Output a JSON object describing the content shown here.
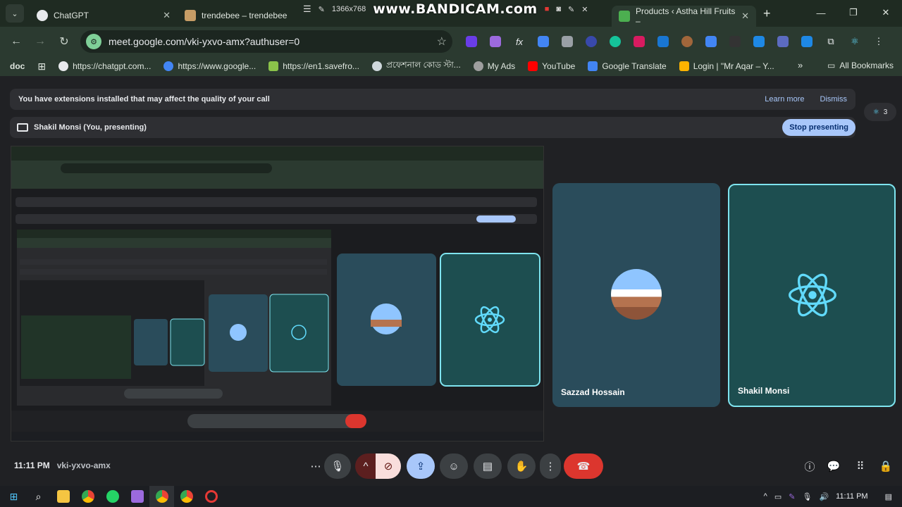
{
  "browser": {
    "tabs": [
      {
        "title": "ChatGPT",
        "color": "#e8eaed"
      },
      {
        "title": "trendebee – trendebee",
        "color": "#c79d66"
      },
      {
        "title": "Products ‹ Astha Hill Fruits –",
        "color": "#4caf50"
      }
    ],
    "recorder": {
      "resolution": "1366x768",
      "watermark": "www.BANDICAM.com"
    },
    "address": "meet.google.com/vki-yxvo-amx?authuser=0",
    "bookmarks": [
      {
        "label": "doc",
        "color": "#e8eaed"
      },
      {
        "label": "https://chatgpt.com...",
        "color": "#e8eaed"
      },
      {
        "label": "https://www.google...",
        "color": "#4285f4"
      },
      {
        "label": "https://en1.savefro...",
        "color": "#8bc34a"
      },
      {
        "label": "প্রফেশনাল কোড স্টা...",
        "color": "#cfd8dc"
      },
      {
        "label": "My Ads",
        "color": "#9e9e9e"
      },
      {
        "label": "YouTube",
        "color": "#ff0000"
      },
      {
        "label": "Google Translate",
        "color": "#4285f4"
      },
      {
        "label": "Login | \"Mr Aqar – Y...",
        "color": "#ffb300"
      }
    ],
    "all_bookmarks": "All Bookmarks"
  },
  "meet": {
    "notice": "You have extensions installed that may affect the quality of your call",
    "learn_more": "Learn more",
    "dismiss": "Dismiss",
    "people_count": "3",
    "presenting": "Shakil Monsi (You, presenting)",
    "stop_presenting": "Stop presenting",
    "participants": [
      {
        "name": "Sazzad Hossain"
      },
      {
        "name": "Shakil Monsi"
      }
    ],
    "time": "11:11 PM",
    "meeting_code": "vki-yxvo-amx",
    "accent": "#7fe4ef",
    "end_call_color": "#dc362e"
  },
  "taskbar": {
    "time": "11:11 PM"
  }
}
